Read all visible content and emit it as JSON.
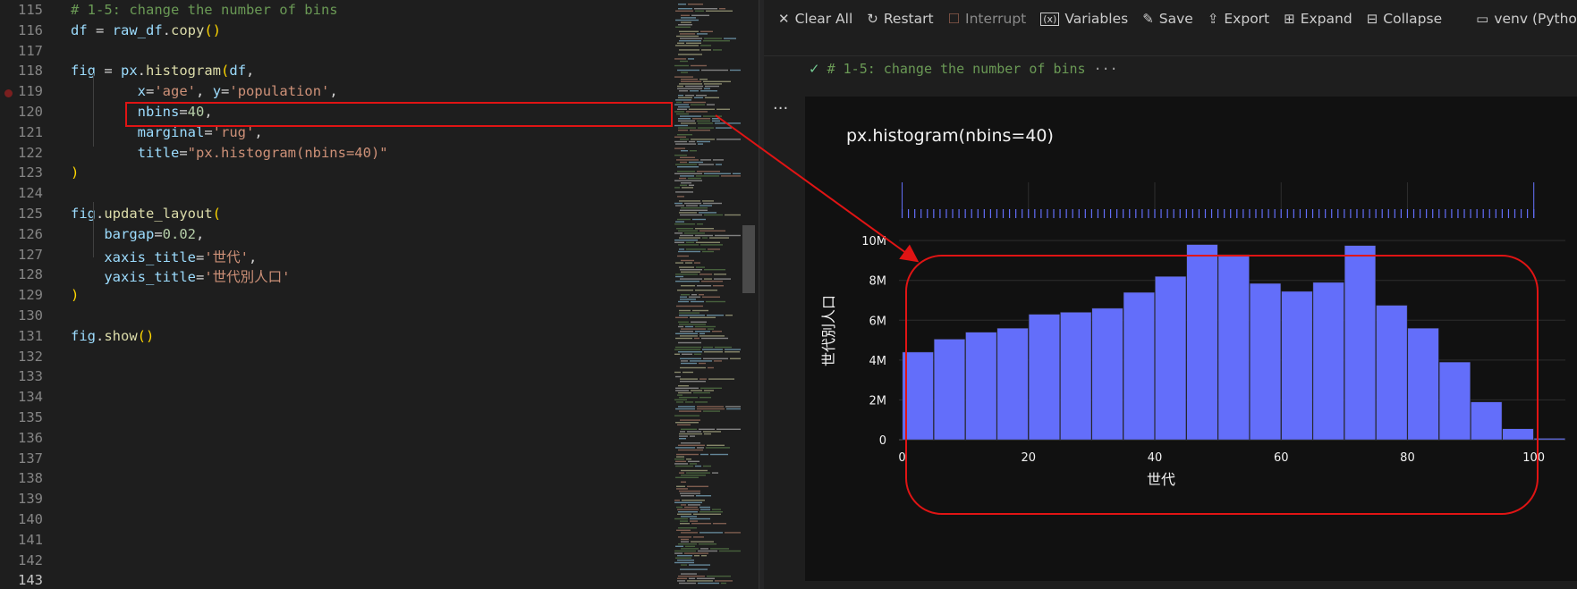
{
  "editor": {
    "lines": [
      {
        "num": "115",
        "tokens": [
          [
            "c-com",
            "# 1-5: change the number of bins"
          ]
        ]
      },
      {
        "num": "116",
        "tokens": [
          [
            "c-var",
            "df"
          ],
          [
            "c-op",
            " = "
          ],
          [
            "c-var",
            "raw_df"
          ],
          [
            "c-op",
            "."
          ],
          [
            "c-fn",
            "copy"
          ],
          [
            "c-par",
            "()"
          ]
        ]
      },
      {
        "num": "117",
        "tokens": []
      },
      {
        "num": "118",
        "tokens": [
          [
            "c-var",
            "fig"
          ],
          [
            "c-op",
            " = "
          ],
          [
            "c-var",
            "px"
          ],
          [
            "c-op",
            "."
          ],
          [
            "c-fn",
            "histogram"
          ],
          [
            "c-par",
            "("
          ],
          [
            "c-var",
            "df"
          ],
          [
            "c-op",
            ","
          ]
        ]
      },
      {
        "num": "119",
        "tokens": [
          [
            "c-op",
            "        "
          ],
          [
            "c-var",
            "x"
          ],
          [
            "c-op",
            "="
          ],
          [
            "c-str",
            "'age'"
          ],
          [
            "c-op",
            ", "
          ],
          [
            "c-var",
            "y"
          ],
          [
            "c-op",
            "="
          ],
          [
            "c-str",
            "'population'"
          ],
          [
            "c-op",
            ","
          ]
        ]
      },
      {
        "num": "120",
        "tokens": [
          [
            "c-op",
            "        "
          ],
          [
            "c-var",
            "nbins"
          ],
          [
            "c-op",
            "="
          ],
          [
            "c-num",
            "40"
          ],
          [
            "c-op",
            ","
          ]
        ]
      },
      {
        "num": "121",
        "tokens": [
          [
            "c-op",
            "        "
          ],
          [
            "c-var",
            "marginal"
          ],
          [
            "c-op",
            "="
          ],
          [
            "c-str",
            "'rug'"
          ],
          [
            "c-op",
            ","
          ]
        ]
      },
      {
        "num": "122",
        "tokens": [
          [
            "c-op",
            "        "
          ],
          [
            "c-var",
            "title"
          ],
          [
            "c-op",
            "="
          ],
          [
            "c-str",
            "\"px.histogram(nbins=40)\""
          ]
        ]
      },
      {
        "num": "123",
        "tokens": [
          [
            "c-par",
            ")"
          ]
        ]
      },
      {
        "num": "124",
        "tokens": []
      },
      {
        "num": "125",
        "tokens": [
          [
            "c-var",
            "fig"
          ],
          [
            "c-op",
            "."
          ],
          [
            "c-fn",
            "update_layout"
          ],
          [
            "c-par",
            "("
          ]
        ]
      },
      {
        "num": "126",
        "tokens": [
          [
            "c-op",
            "    "
          ],
          [
            "c-var",
            "bargap"
          ],
          [
            "c-op",
            "="
          ],
          [
            "c-num",
            "0.02"
          ],
          [
            "c-op",
            ","
          ]
        ]
      },
      {
        "num": "127",
        "tokens": [
          [
            "c-op",
            "    "
          ],
          [
            "c-var",
            "xaxis_title"
          ],
          [
            "c-op",
            "="
          ],
          [
            "c-str",
            "'世代'"
          ],
          [
            "c-op",
            ","
          ]
        ]
      },
      {
        "num": "128",
        "tokens": [
          [
            "c-op",
            "    "
          ],
          [
            "c-var",
            "yaxis_title"
          ],
          [
            "c-op",
            "="
          ],
          [
            "c-str",
            "'世代別人口'"
          ]
        ]
      },
      {
        "num": "129",
        "tokens": [
          [
            "c-par",
            ")"
          ]
        ]
      },
      {
        "num": "130",
        "tokens": []
      },
      {
        "num": "131",
        "tokens": [
          [
            "c-var",
            "fig"
          ],
          [
            "c-op",
            "."
          ],
          [
            "c-fn",
            "show"
          ],
          [
            "c-par",
            "()"
          ]
        ]
      },
      {
        "num": "132",
        "tokens": []
      },
      {
        "num": "133",
        "tokens": []
      },
      {
        "num": "134",
        "tokens": []
      },
      {
        "num": "135",
        "tokens": []
      },
      {
        "num": "136",
        "tokens": []
      },
      {
        "num": "137",
        "tokens": []
      },
      {
        "num": "138",
        "tokens": []
      },
      {
        "num": "139",
        "tokens": []
      },
      {
        "num": "140",
        "tokens": []
      },
      {
        "num": "141",
        "tokens": []
      },
      {
        "num": "142",
        "tokens": []
      },
      {
        "num": "143",
        "tokens": []
      }
    ],
    "breakpoint_line": "119",
    "highlighted_line": "120"
  },
  "toolbar": {
    "clear_all": "Clear All",
    "restart": "Restart",
    "interrupt": "Interrupt",
    "variables": "Variables",
    "save": "Save",
    "export": "Export",
    "expand": "Expand",
    "collapse": "Collapse",
    "kernel": "venv (Python"
  },
  "icons": {
    "clear_all": "close-icon",
    "restart": "restart-icon",
    "interrupt": "stop-icon",
    "variables": "variables-icon",
    "save": "save-icon",
    "export": "export-icon",
    "expand": "expand-icon",
    "collapse": "collapse-icon",
    "kernel": "kernel-icon"
  },
  "cell": {
    "header": "# 1-5: change the number of bins",
    "more": "···",
    "side_ellipsis": "..."
  },
  "colors": {
    "bar": "#636efa",
    "annotation": "#e01414",
    "plot_bg": "#111111"
  },
  "chart_data": {
    "type": "bar",
    "title": "px.histogram(nbins=40)",
    "xlabel": "世代",
    "ylabel": "世代別人口",
    "bin_size": 5,
    "bin_starts": [
      0,
      5,
      10,
      15,
      20,
      25,
      30,
      35,
      40,
      45,
      50,
      55,
      60,
      65,
      70,
      75,
      80,
      85,
      90,
      95,
      100
    ],
    "values": [
      4.4,
      5.05,
      5.4,
      5.6,
      6.3,
      6.4,
      6.6,
      7.4,
      8.2,
      9.8,
      9.3,
      7.85,
      7.45,
      7.9,
      9.75,
      6.75,
      5.6,
      3.9,
      1.9,
      0.55,
      0.07
    ],
    "xlim": [
      -0.5,
      105
    ],
    "ylim": [
      0,
      10.5
    ],
    "x_ticks": [
      "0",
      "20",
      "40",
      "60",
      "80",
      "100"
    ],
    "x_tick_values": [
      0,
      20,
      40,
      60,
      80,
      100
    ],
    "y_ticks": [
      "0",
      "2M",
      "4M",
      "6M",
      "8M",
      "10M"
    ],
    "y_tick_values": [
      0,
      2,
      4,
      6,
      8,
      10
    ],
    "marginal": "rug",
    "rug_ages": [
      0,
      1,
      2,
      3,
      4,
      5,
      6,
      7,
      8,
      9,
      10,
      11,
      12,
      13,
      14,
      15,
      16,
      17,
      18,
      19,
      20,
      21,
      22,
      23,
      24,
      25,
      26,
      27,
      28,
      29,
      30,
      31,
      32,
      33,
      34,
      35,
      36,
      37,
      38,
      39,
      40,
      41,
      42,
      43,
      44,
      45,
      46,
      47,
      48,
      49,
      50,
      51,
      52,
      53,
      54,
      55,
      56,
      57,
      58,
      59,
      60,
      61,
      62,
      63,
      64,
      65,
      66,
      67,
      68,
      69,
      70,
      71,
      72,
      73,
      74,
      75,
      76,
      77,
      78,
      79,
      80,
      81,
      82,
      83,
      84,
      85,
      86,
      87,
      88,
      89,
      90,
      91,
      92,
      93,
      94,
      95,
      96,
      97,
      98,
      99,
      100
    ],
    "grid": true,
    "legend": "none"
  }
}
